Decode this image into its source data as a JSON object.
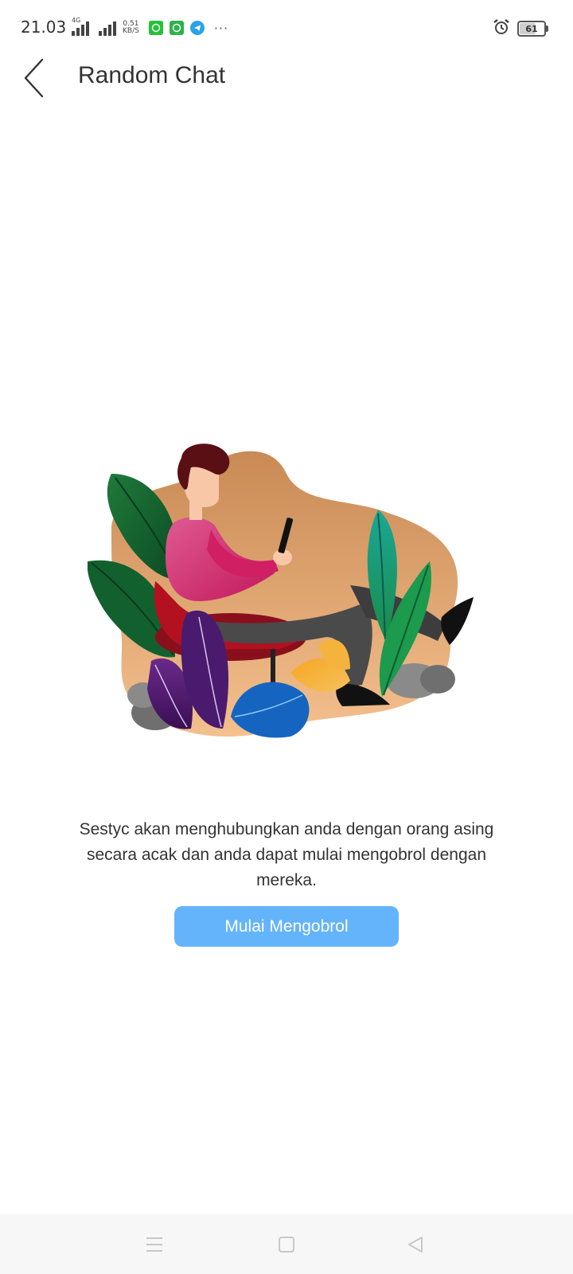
{
  "status_bar": {
    "time": "21.03",
    "network_type": "4G",
    "net_speed_value": "0.51",
    "net_speed_unit": "KB/S",
    "battery_level": "61",
    "more_indicator": "···"
  },
  "app_bar": {
    "title": "Random Chat"
  },
  "main": {
    "description": "Sestyc akan menghubungkan anda dengan orang asing secara acak dan anda dapat mulai mengobrol dengan mereka.",
    "start_button_label": "Mulai Mengobrol"
  },
  "colors": {
    "button": "#64b4fb",
    "text": "#333333",
    "nav_bg": "#f7f7f7"
  }
}
